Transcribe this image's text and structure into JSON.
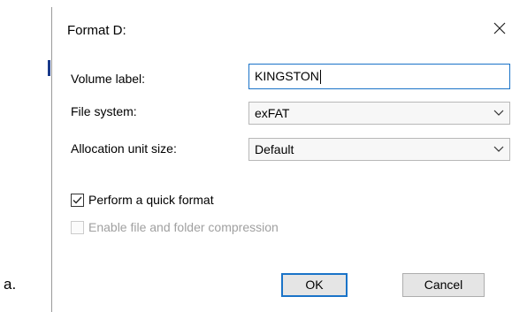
{
  "list_marker": "a.",
  "dialog": {
    "title": "Format D:",
    "volume_label": {
      "label": "Volume label:",
      "value": "KINGSTON"
    },
    "file_system": {
      "label": "File system:",
      "selected": "exFAT"
    },
    "allocation_unit_size": {
      "label": "Allocation unit size:",
      "selected": "Default"
    },
    "quick_format": {
      "label": "Perform a quick format",
      "checked": true
    },
    "compression": {
      "label": "Enable file and folder compression",
      "checked": false,
      "enabled": false
    },
    "buttons": {
      "ok": "OK",
      "cancel": "Cancel"
    }
  },
  "icons": {
    "close": "close-icon",
    "dropdown": "chevron-down-icon",
    "check": "checkmark-icon"
  },
  "colors": {
    "accent": "#1a73c8",
    "disabled_text": "#a0a0a0",
    "button_bg": "#e5e5e5"
  }
}
